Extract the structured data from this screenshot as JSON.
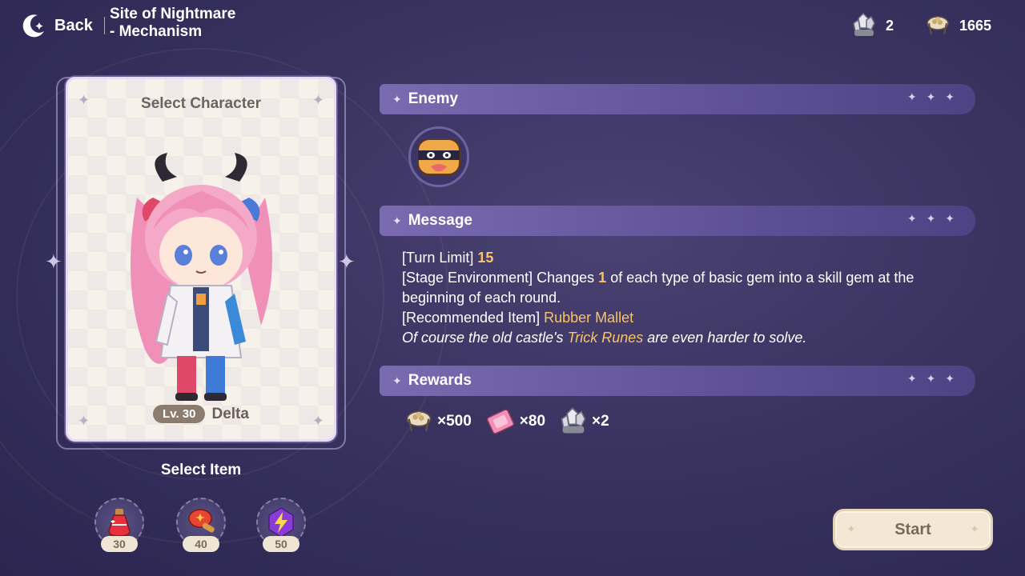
{
  "header": {
    "back_label": "Back",
    "stage_title_line1": "Site of Nightmare",
    "stage_title_line2": "- Mechanism"
  },
  "currencies": [
    {
      "icon": "crystal-icon",
      "value": "2"
    },
    {
      "icon": "coin-tray-icon",
      "value": "1665"
    }
  ],
  "character_card": {
    "title": "Select Character",
    "level": "Lv. 30",
    "name": "Delta"
  },
  "items": {
    "title": "Select Item",
    "list": [
      {
        "icon": "potion-icon",
        "cost": "30"
      },
      {
        "icon": "hammer-icon",
        "cost": "40"
      },
      {
        "icon": "lightning-gem-icon",
        "cost": "50"
      }
    ]
  },
  "enemy": {
    "header": "Enemy"
  },
  "message": {
    "header": "Message",
    "turn_limit_label": "[Turn Limit]",
    "turn_limit_value": "15",
    "env_label": "[Stage Environment] Changes",
    "env_value": "1",
    "env_text": "of each type of basic gem into a skill gem at the beginning of each round.",
    "rec_label": "[Recommended Item]",
    "rec_value": "Rubber Mallet",
    "flavor_pre": "Of course the old castle's",
    "flavor_hl": "Trick Runes",
    "flavor_post": "are even harder to solve."
  },
  "rewards": {
    "header": "Rewards",
    "list": [
      {
        "icon": "coin-tray-icon",
        "qty": "×500"
      },
      {
        "icon": "ticket-icon",
        "qty": "×80"
      },
      {
        "icon": "crystal-icon",
        "qty": "×2"
      }
    ]
  },
  "start_label": "Start",
  "colors": {
    "accent_gold": "#f7c46a",
    "header_bar": "#6a5ca4",
    "background": "#3a3360"
  }
}
